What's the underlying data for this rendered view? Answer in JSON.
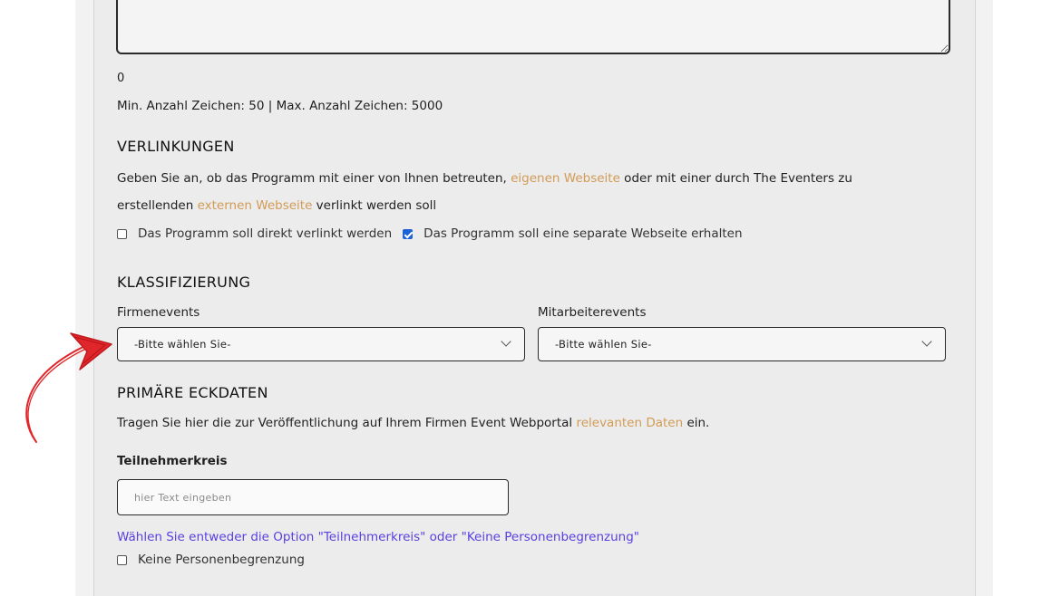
{
  "description": {
    "counter_value": "0",
    "limits_text": "Min. Anzahl Zeichen: 50 | Max. Anzahl Zeichen: 5000"
  },
  "verlinkungen": {
    "heading": "VERLINKUNGEN",
    "text_part1": "Geben Sie an, ob das Programm mit einer von Ihnen betreuten, ",
    "link1": "eigenen Webseite",
    "text_part2": " oder mit einer durch The Eventers zu",
    "text_part3": "erstellenden ",
    "link2": "externen Webseite",
    "text_part4": " verlinkt werden soll",
    "option_direct_label": "Das Programm soll direkt verlinkt werden",
    "option_direct_checked": false,
    "option_separate_label": "Das Programm soll eine separate Webseite erhalten",
    "option_separate_checked": true
  },
  "klassifizierung": {
    "heading": "KLASSIFIZIERUNG",
    "firmenevents_label": "Firmenevents",
    "firmenevents_value": "-Bitte wählen Sie-",
    "mitarbeiterevents_label": "Mitarbeiterevents",
    "mitarbeiterevents_value": "-Bitte wählen Sie-"
  },
  "eckdaten": {
    "heading": "PRIMÄRE ECKDATEN",
    "text_part1": "Tragen Sie hier die zur Veröffentlichung auf Ihrem Firmen Event Webportal ",
    "link": "relevanten Daten",
    "text_part2": " ein.",
    "teilnehmerkreis_label": "Teilnehmerkreis",
    "teilnehmerkreis_placeholder": "hier Text eingeben",
    "hint": "Wählen Sie entweder die Option \"Teilnehmerkreis\" oder \"Keine Personenbegrenzung\"",
    "keine_begrenzung_label": "Keine Personenbegrenzung",
    "keine_begrenzung_checked": false
  },
  "colors": {
    "link": "#d29b56",
    "hint": "#5a3fe0",
    "checkbox_checked": "#1a62d6",
    "annotation_arrow": "#e0262b"
  },
  "annotation": {
    "icon": "red-hand-drawn-arrow-icon"
  }
}
